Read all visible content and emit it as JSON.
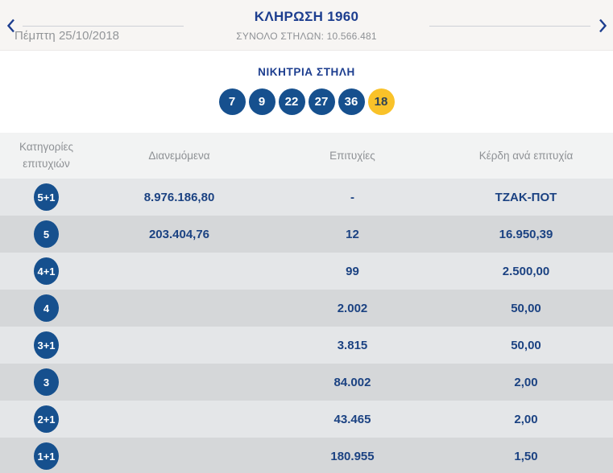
{
  "colors": {
    "brand_navy": "#1d3e8f",
    "value_navy": "#1b4282",
    "ball_blue": "#16508e",
    "joker_yellow": "#f9c229",
    "joker_text": "#2d4256",
    "muted_gray": "#8e9195",
    "row_light": "#e4e6e8",
    "row_dark": "#d5d7d9",
    "band_bg": "#f7f5f3",
    "table_head_bg": "#f2f3f3"
  },
  "header": {
    "title": "ΚΛΗΡΩΣΗ 1960",
    "total_columns": "ΣΥΝΟΛΟ ΣΤΗΛΩΝ: 10.566.481",
    "date": "Πέμπτη 25/10/2018",
    "icons": {
      "prev": "chevron-left",
      "next": "chevron-right"
    }
  },
  "winning": {
    "title": "ΝΙΚΗΤΡΙΑ ΣΤΗΛΗ",
    "numbers": [
      "7",
      "9",
      "22",
      "27",
      "36"
    ],
    "joker": "18"
  },
  "table": {
    "headers": {
      "category": "Κατηγορίες επιτυχιών",
      "distributed": "Διανεμόμενα",
      "winners": "Επιτυχίες",
      "prize": "Κέρδη ανά επιτυχία"
    },
    "rows": [
      {
        "category": "5+1",
        "distributed": "8.976.186,80",
        "winners": "-",
        "prize": "ΤΖΑΚ-ΠΟΤ"
      },
      {
        "category": "5",
        "distributed": "203.404,76",
        "winners": "12",
        "prize": "16.950,39"
      },
      {
        "category": "4+1",
        "distributed": "",
        "winners": "99",
        "prize": "2.500,00"
      },
      {
        "category": "4",
        "distributed": "",
        "winners": "2.002",
        "prize": "50,00"
      },
      {
        "category": "3+1",
        "distributed": "",
        "winners": "3.815",
        "prize": "50,00"
      },
      {
        "category": "3",
        "distributed": "",
        "winners": "84.002",
        "prize": "2,00"
      },
      {
        "category": "2+1",
        "distributed": "",
        "winners": "43.465",
        "prize": "2,00"
      },
      {
        "category": "1+1",
        "distributed": "",
        "winners": "180.955",
        "prize": "1,50"
      }
    ]
  }
}
